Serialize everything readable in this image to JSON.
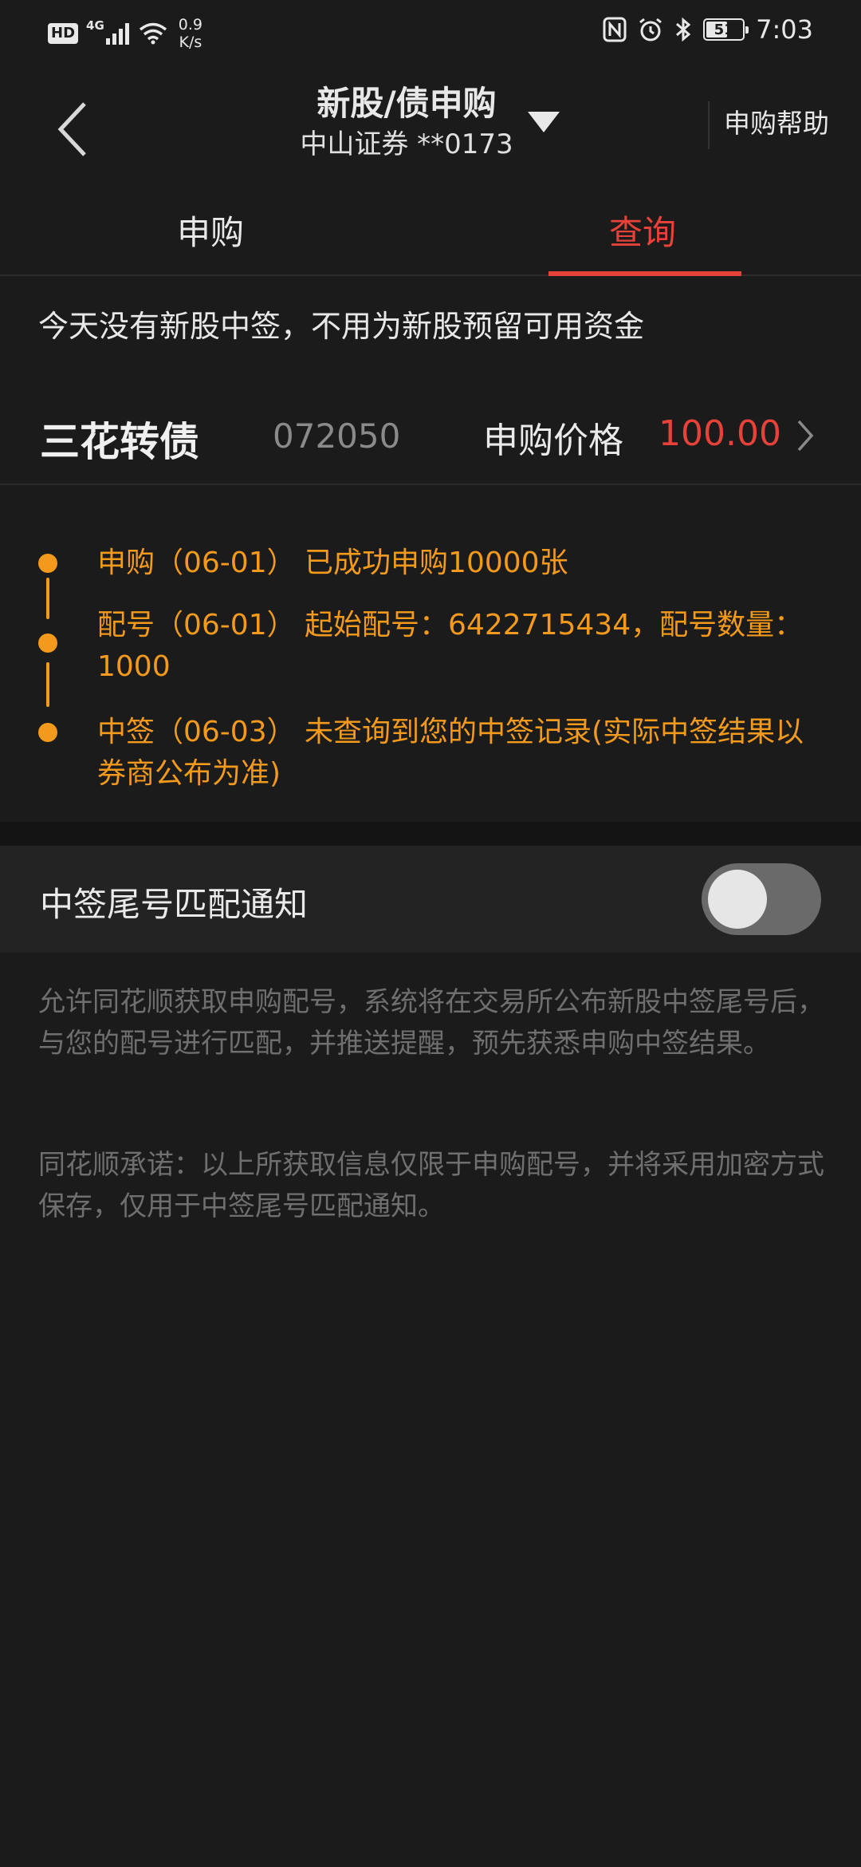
{
  "status_bar": {
    "hd": "HD",
    "network": "4G",
    "speed_value": "0.9",
    "speed_unit": "K/s",
    "battery": "51",
    "time": "7:03",
    "icons": [
      "nfc-icon",
      "alarm-icon",
      "bluetooth-icon",
      "battery-icon"
    ]
  },
  "header": {
    "title": "新股/债申购",
    "account": "中山证券 **0173",
    "help": "申购帮助"
  },
  "tabs": [
    {
      "label": "申购",
      "active": false
    },
    {
      "label": "查询",
      "active": true
    }
  ],
  "notice": "今天没有新股中签，不用为新股预留可用资金",
  "bond": {
    "name": "三花转债",
    "code": "072050",
    "price_label": "申购价格",
    "price": "100.00"
  },
  "timeline": [
    {
      "text": "申购（06-01） 已成功申购10000张"
    },
    {
      "text": "配号（06-01） 起始配号：6422715434，配号数量：1000"
    },
    {
      "text": "中签（06-03） 未查询到您的中签记录(实际中签结果以券商公布为准)"
    }
  ],
  "notify": {
    "label": "中签尾号匹配通知",
    "enabled": false
  },
  "descriptions": [
    "允许同花顺获取申购配号，系统将在交易所公布新股中签尾号后，与您的配号进行匹配，并推送提醒，预先获悉申购中签结果。",
    "同花顺承诺：以上所获取信息仅限于申购配号，并将采用加密方式保存，仅用于中签尾号匹配通知。"
  ],
  "colors": {
    "background": "#1b1b1c",
    "accent_red": "#e6423a",
    "timeline_orange": "#f39a1c"
  }
}
